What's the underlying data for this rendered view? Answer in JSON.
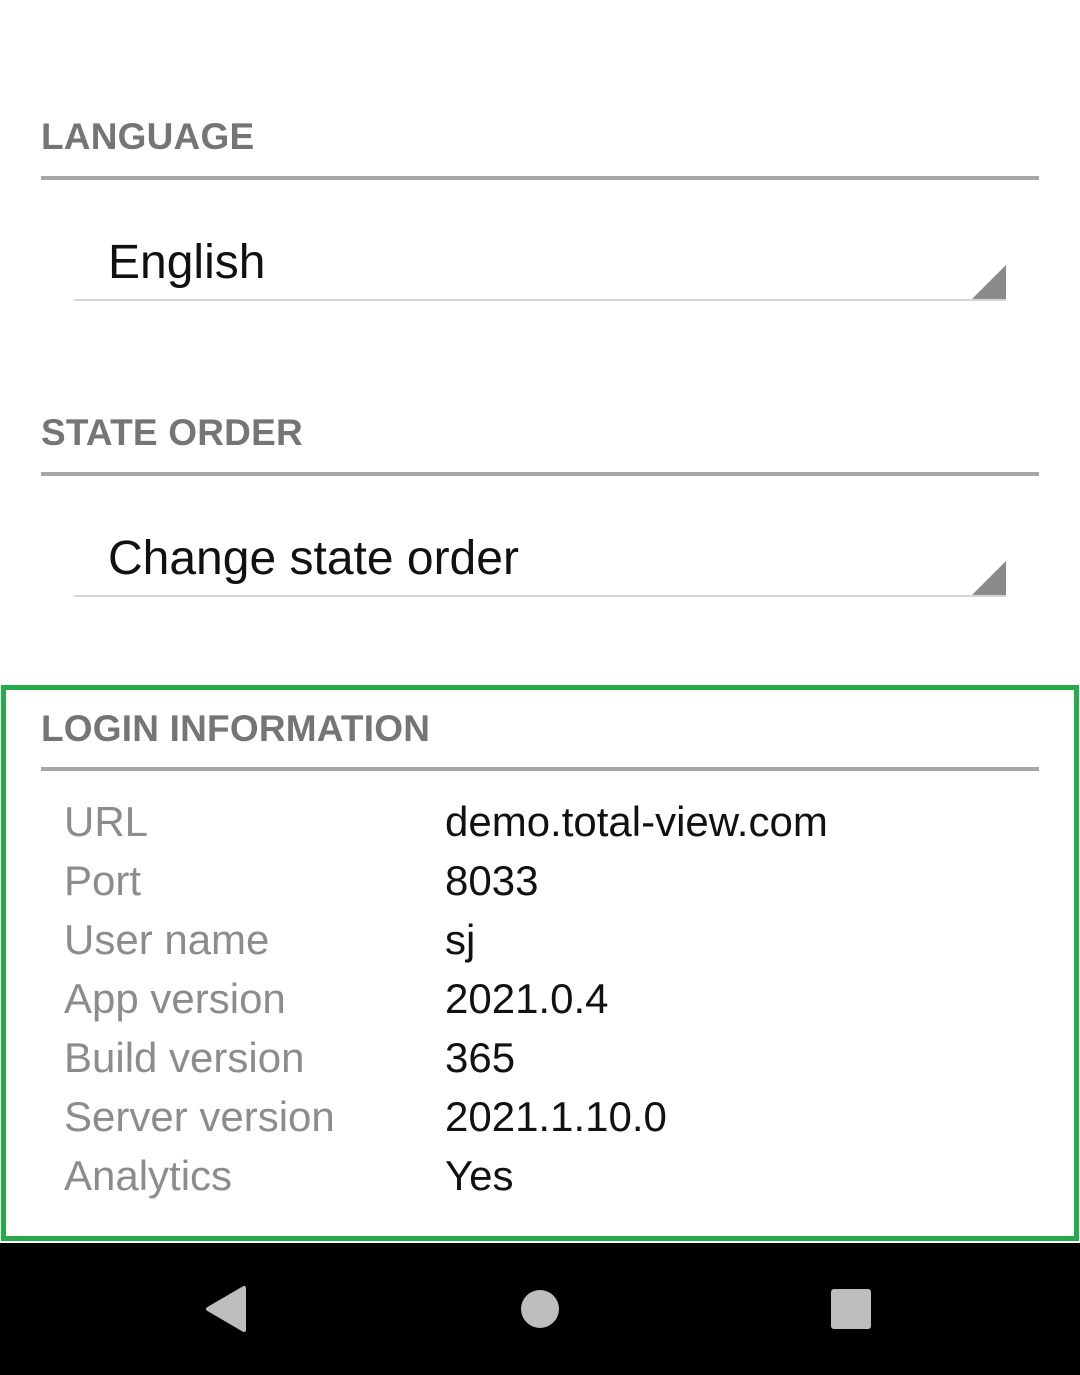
{
  "language": {
    "header": "LANGUAGE",
    "selected": "English"
  },
  "state_order": {
    "header": "STATE ORDER",
    "selected": "Change state order"
  },
  "login_information": {
    "header": "LOGIN INFORMATION",
    "rows": [
      {
        "label": "URL",
        "value": "demo.total-view.com"
      },
      {
        "label": "Port",
        "value": "8033"
      },
      {
        "label": "User name",
        "value": "sj"
      },
      {
        "label": "App version",
        "value": "2021.0.4"
      },
      {
        "label": "Build version",
        "value": "365"
      },
      {
        "label": "Server version",
        "value": "2021.1.10.0"
      },
      {
        "label": "Analytics",
        "value": "Yes"
      }
    ]
  },
  "colors": {
    "highlight": "#27ab4a",
    "section_header_text": "#757575",
    "divider": "#a6a6a6",
    "navbar": "#000000",
    "nav_icon": "#bdbdbd"
  },
  "navbar": {
    "icons": [
      "back-icon",
      "home-icon",
      "recent-apps-icon"
    ]
  }
}
